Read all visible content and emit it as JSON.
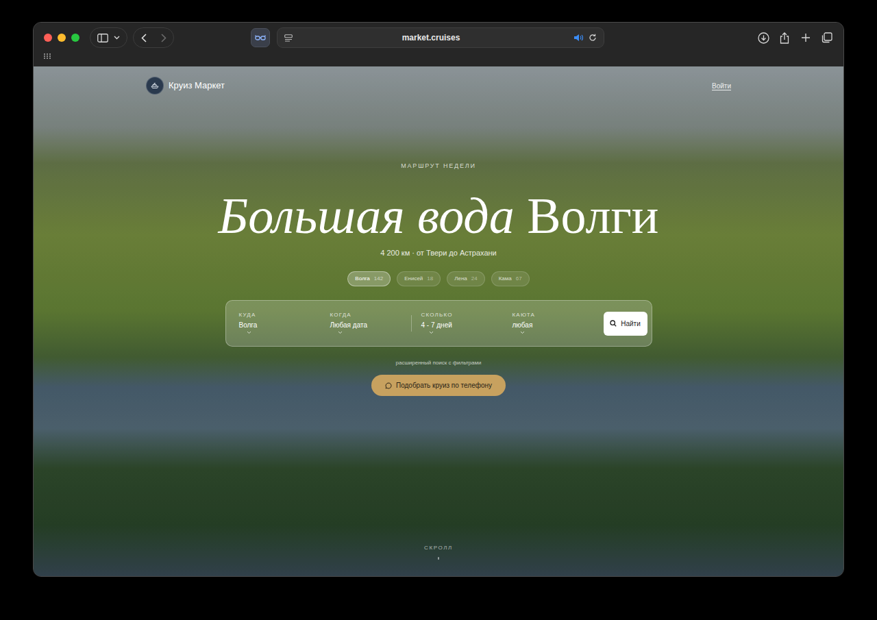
{
  "browser": {
    "url": "market.cruises",
    "audio_playing": true
  },
  "header": {
    "brand": "Круиз Маркет",
    "login": "Войти"
  },
  "hero": {
    "eyebrow": "МАРШРУТ НЕДЕЛИ",
    "title_italic": "Большая вода",
    "title_caps": "Волги",
    "subtitle": "4 200 км · от Твери до Астрахани"
  },
  "rivers": [
    {
      "name": "Волга",
      "count": "142",
      "selected": true
    },
    {
      "name": "Енисей",
      "count": "18",
      "selected": false
    },
    {
      "name": "Лена",
      "count": "24",
      "selected": false
    },
    {
      "name": "Кама",
      "count": "67",
      "selected": false
    }
  ],
  "search": {
    "fields": [
      {
        "label": "КУДА",
        "value": "Волга"
      },
      {
        "label": "КОГДА",
        "value": "Любая дата"
      },
      {
        "label": "СКОЛЬКО",
        "value": "4 - 7 дней"
      },
      {
        "label": "КАЮТА",
        "value": "любая"
      }
    ],
    "button": "Найти",
    "advanced": "расширенный поиск с фильтрами"
  },
  "phone_button": "Подобрать круиз по телефону",
  "scroll": "СКРОЛЛ"
}
